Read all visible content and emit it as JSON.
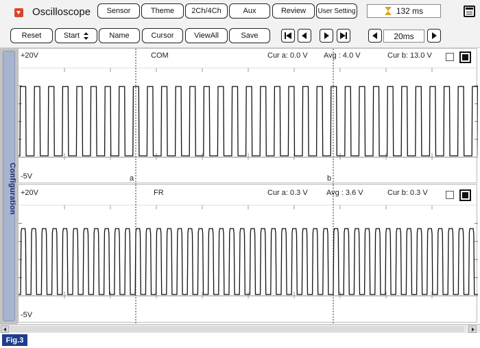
{
  "app": {
    "title": "Oscilloscope"
  },
  "toolbar": {
    "sensor": "Sensor",
    "theme": "Theme",
    "channels": "2Ch/4Ch",
    "aux": "Aux",
    "review": "Review",
    "user_setting": "User Setting",
    "elapsed_time": "132 ms",
    "reset": "Reset",
    "start": "Start",
    "name": "Name",
    "cursor": "Cursor",
    "view_all": "ViewAll",
    "save": "Save",
    "time_division": "20ms"
  },
  "sidebar": {
    "label": "Configuration"
  },
  "panels": [
    {
      "channel": "COM",
      "y_max_label": "+20V",
      "y_min_label": "-5V",
      "cur_a": "Cur a: 0.0 V",
      "avg": "Avg : 4.0 V",
      "cur_b": "Cur b: 13.0 V",
      "cursor_a_label": "a",
      "cursor_b_label": "b"
    },
    {
      "channel": "FR",
      "y_max_label": "+20V",
      "y_min_label": "-5V",
      "cur_a": "Cur a: 0.3 V",
      "avg": "Avg : 3.6 V",
      "cur_b": "Cur b: 0.3 V"
    }
  ],
  "figure_label": "Fig.3"
}
